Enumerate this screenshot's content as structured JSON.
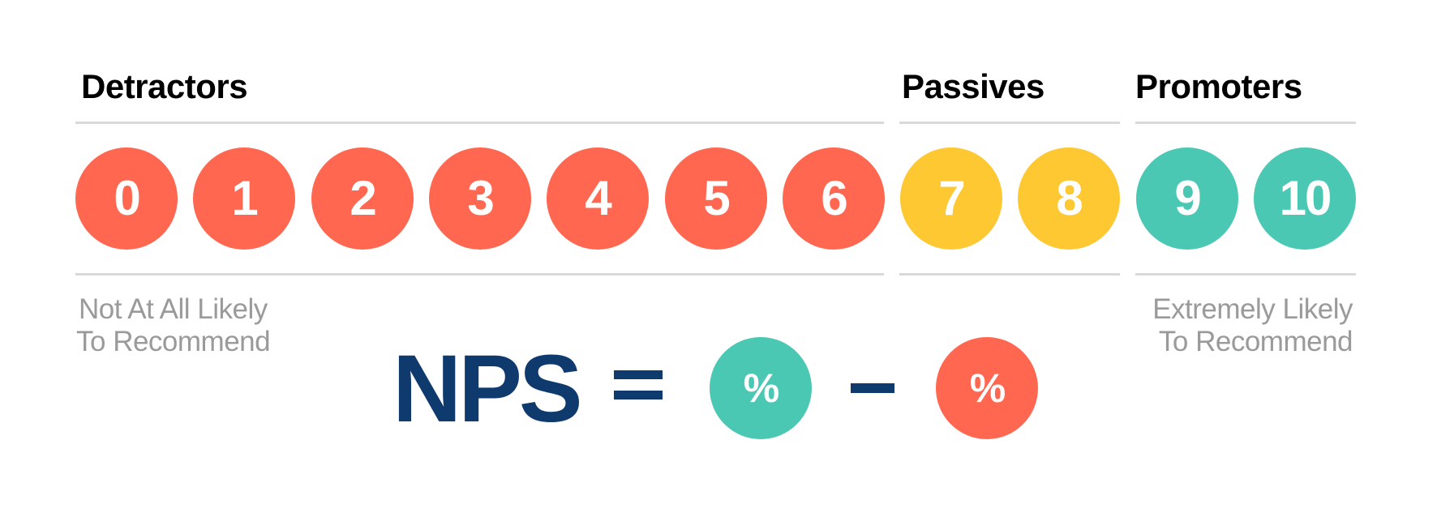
{
  "colors": {
    "detractor": "#FF6750",
    "passive": "#FEC832",
    "promoter": "#4BC8B3",
    "formula": "#0F3A6E"
  },
  "groups": {
    "detractors": "Detractors",
    "passives": "Passives",
    "promoters": "Promoters"
  },
  "scale": [
    {
      "value": "0",
      "group": "detractor"
    },
    {
      "value": "1",
      "group": "detractor"
    },
    {
      "value": "2",
      "group": "detractor"
    },
    {
      "value": "3",
      "group": "detractor"
    },
    {
      "value": "4",
      "group": "detractor"
    },
    {
      "value": "5",
      "group": "detractor"
    },
    {
      "value": "6",
      "group": "detractor"
    },
    {
      "value": "7",
      "group": "passive"
    },
    {
      "value": "8",
      "group": "passive"
    },
    {
      "value": "9",
      "group": "promoter"
    },
    {
      "value": "10",
      "group": "promoter"
    }
  ],
  "captions": {
    "low_line1": "Not At All Likely",
    "low_line2": "To Recommend",
    "high_line1": "Extremely Likely",
    "high_line2": "To Recommend"
  },
  "formula": {
    "label": "NPS",
    "promoter_symbol": "%",
    "detractor_symbol": "%"
  }
}
